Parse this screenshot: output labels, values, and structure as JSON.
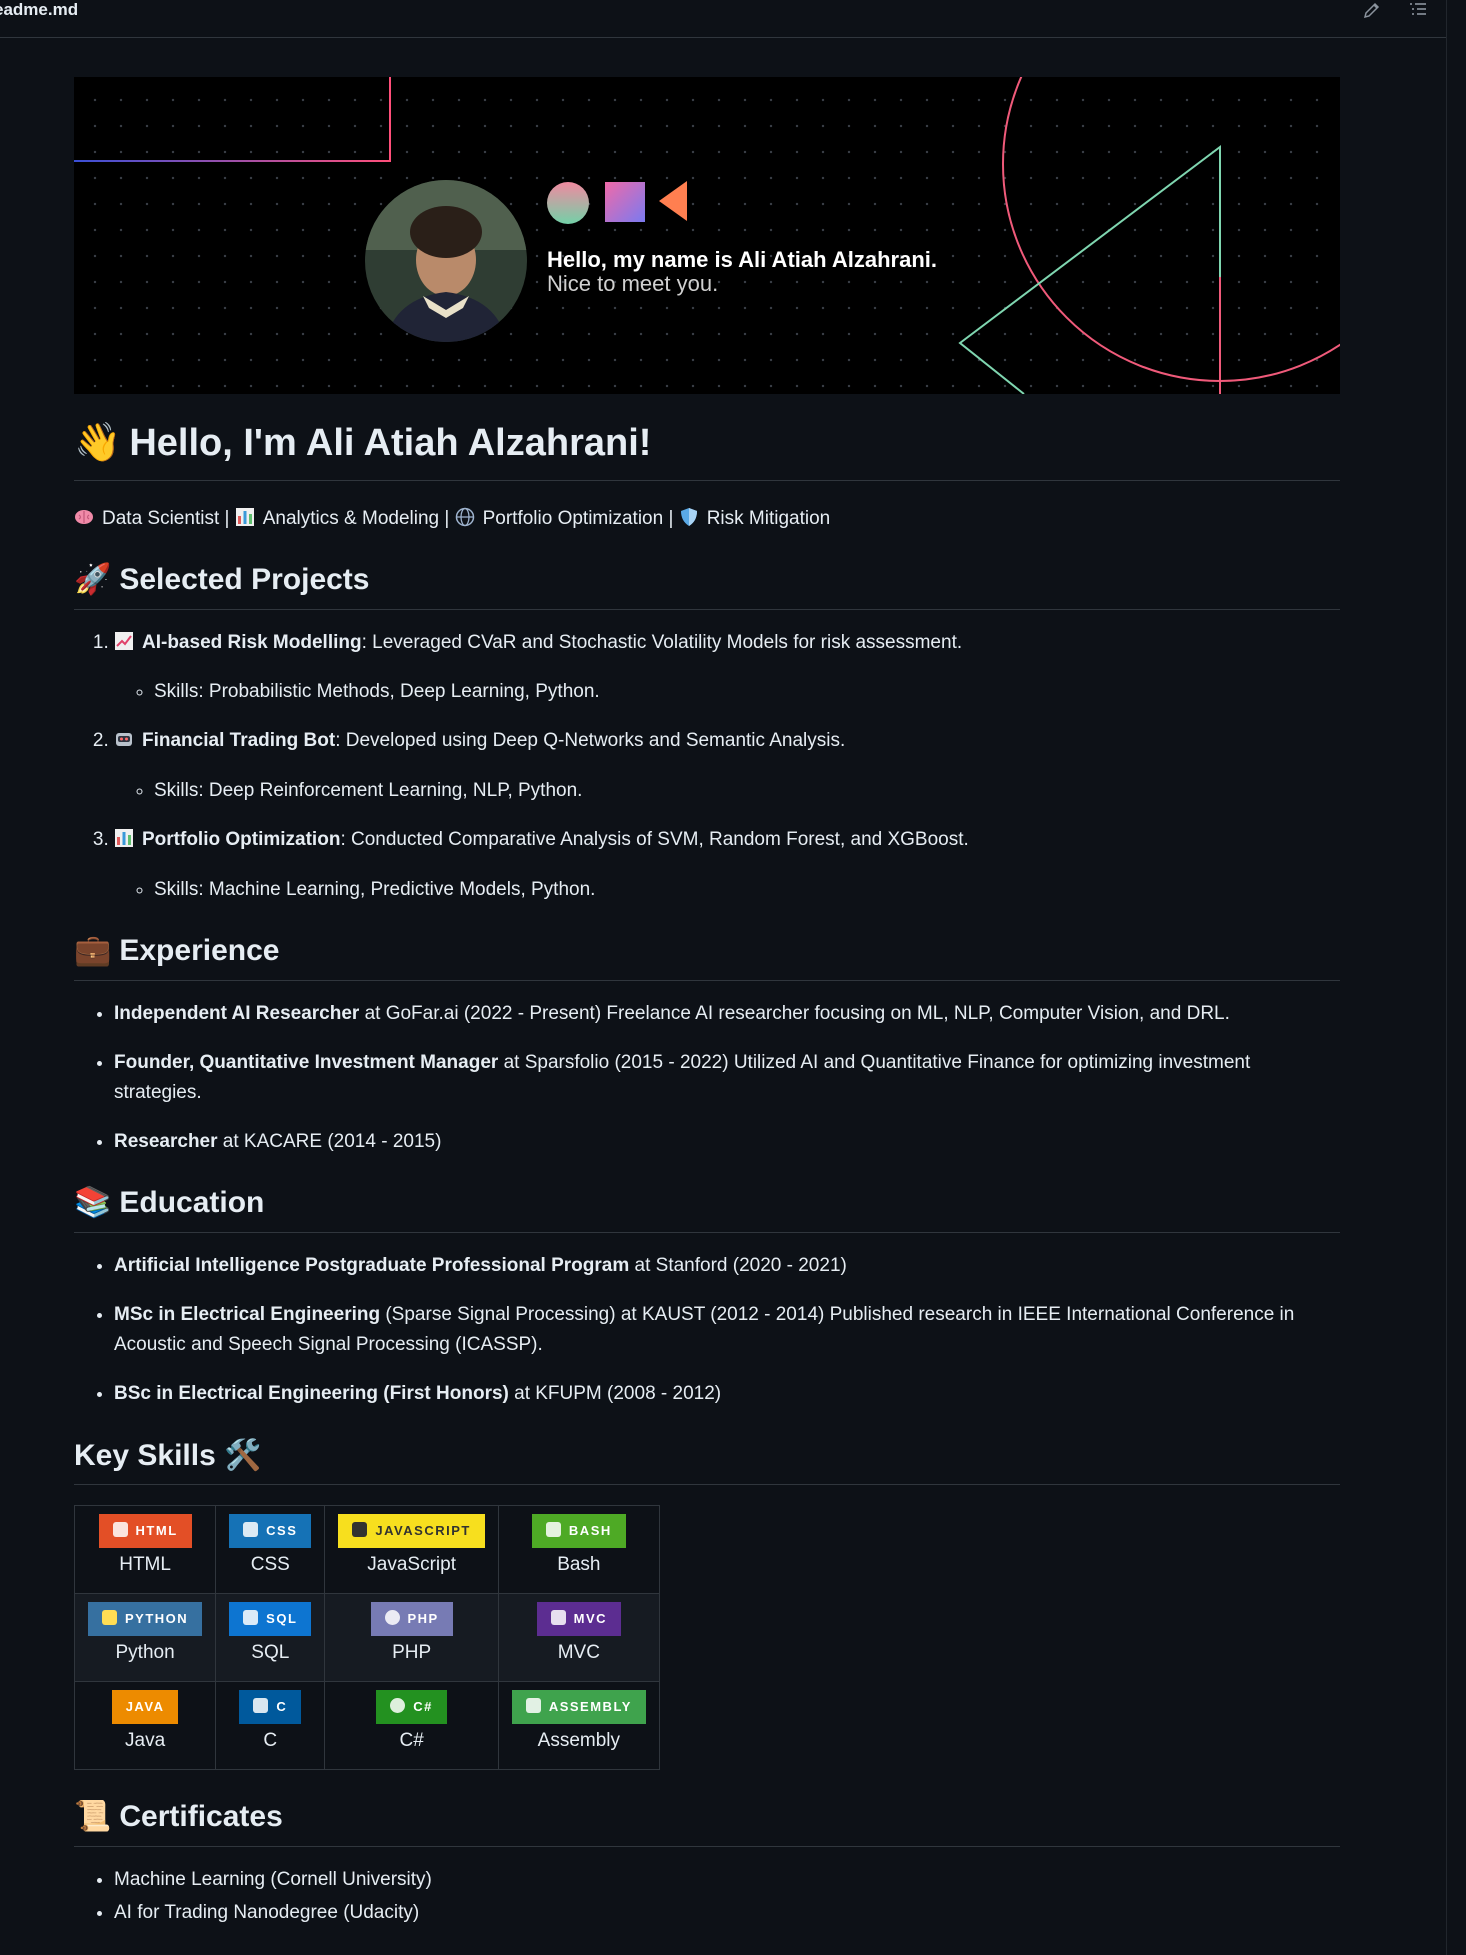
{
  "topbar": {
    "filename": "eadme.md"
  },
  "banner": {
    "greeting": "Hello, my name is Ali Atiah Alzahrani.",
    "subtitle": "Nice to meet you."
  },
  "heading": {
    "emoji": "👋",
    "text": "Hello, I'm Ali Atiah Alzahrani!"
  },
  "tagline": {
    "items": [
      "Data Scientist",
      "Analytics & Modeling",
      "Portfolio Optimization",
      "Risk Mitigation"
    ],
    "separator": "|"
  },
  "projects": {
    "title": "Selected Projects",
    "items": [
      {
        "name": "AI-based Risk Modelling",
        "desc": ": Leveraged CVaR and Stochastic Volatility Models for risk assessment.",
        "skills": "Skills: Probabilistic Methods, Deep Learning, Python."
      },
      {
        "name": "Financial Trading Bot",
        "desc": ": Developed using Deep Q-Networks and Semantic Analysis.",
        "skills": "Skills: Deep Reinforcement Learning, NLP, Python."
      },
      {
        "name": "Portfolio Optimization",
        "desc": ": Conducted Comparative Analysis of SVM, Random Forest, and XGBoost.",
        "skills": "Skills: Machine Learning, Predictive Models, Python."
      }
    ]
  },
  "experience": {
    "title": "Experience",
    "items": [
      {
        "role": "Independent AI Researcher",
        "rest": " at GoFar.ai (2022 - Present) Freelance AI researcher focusing on ML, NLP, Computer Vision, and DRL."
      },
      {
        "role": "Founder, Quantitative Investment Manager",
        "rest": " at Sparsfolio (2015 - 2022) Utilized AI and Quantitative Finance for optimizing investment strategies."
      },
      {
        "role": "Researcher",
        "rest": " at KACARE (2014 - 2015)"
      }
    ]
  },
  "education": {
    "title": "Education",
    "items": [
      {
        "degree": "Artificial Intelligence Postgraduate Professional Program",
        "rest": " at Stanford (2020 - 2021)"
      },
      {
        "degree": "MSc in Electrical Engineering",
        "rest": " (Sparse Signal Processing) at KAUST (2012 - 2014) Published research in IEEE International Conference in Acoustic and Speech Signal Processing (ICASSP)."
      },
      {
        "degree": "BSc in Electrical Engineering (First Honors)",
        "rest": " at KFUPM (2008 - 2012)"
      }
    ]
  },
  "skills": {
    "title": "Key Skills",
    "emoji": "🛠️",
    "badges": [
      {
        "badge": "HTML",
        "label": "HTML",
        "color": "#e34f26"
      },
      {
        "badge": "CSS",
        "label": "CSS",
        "color": "#1572b6"
      },
      {
        "badge": "JAVASCRIPT",
        "label": "JavaScript",
        "color": "#f7df1e"
      },
      {
        "badge": "BASH",
        "label": "Bash",
        "color": "#4eaa25"
      },
      {
        "badge": "PYTHON",
        "label": "Python",
        "color": "#3670a0"
      },
      {
        "badge": "SQL",
        "label": "SQL",
        "color": "#0d75d1"
      },
      {
        "badge": "PHP",
        "label": "PHP",
        "color": "#777bb4"
      },
      {
        "badge": "MVC",
        "label": "MVC",
        "color": "#5c2d91"
      },
      {
        "badge": "JAVA",
        "label": "Java",
        "color": "#ed8b00"
      },
      {
        "badge": "C",
        "label": "C",
        "color": "#00599c"
      },
      {
        "badge": "C#",
        "label": "C#",
        "color": "#239120"
      },
      {
        "badge": "ASSEMBLY",
        "label": "Assembly",
        "color": "#3fa34d"
      }
    ]
  },
  "certificates": {
    "title": "Certificates",
    "items": [
      "Machine Learning (Cornell University)",
      "AI for Trading Nanodegree (Udacity)"
    ]
  }
}
